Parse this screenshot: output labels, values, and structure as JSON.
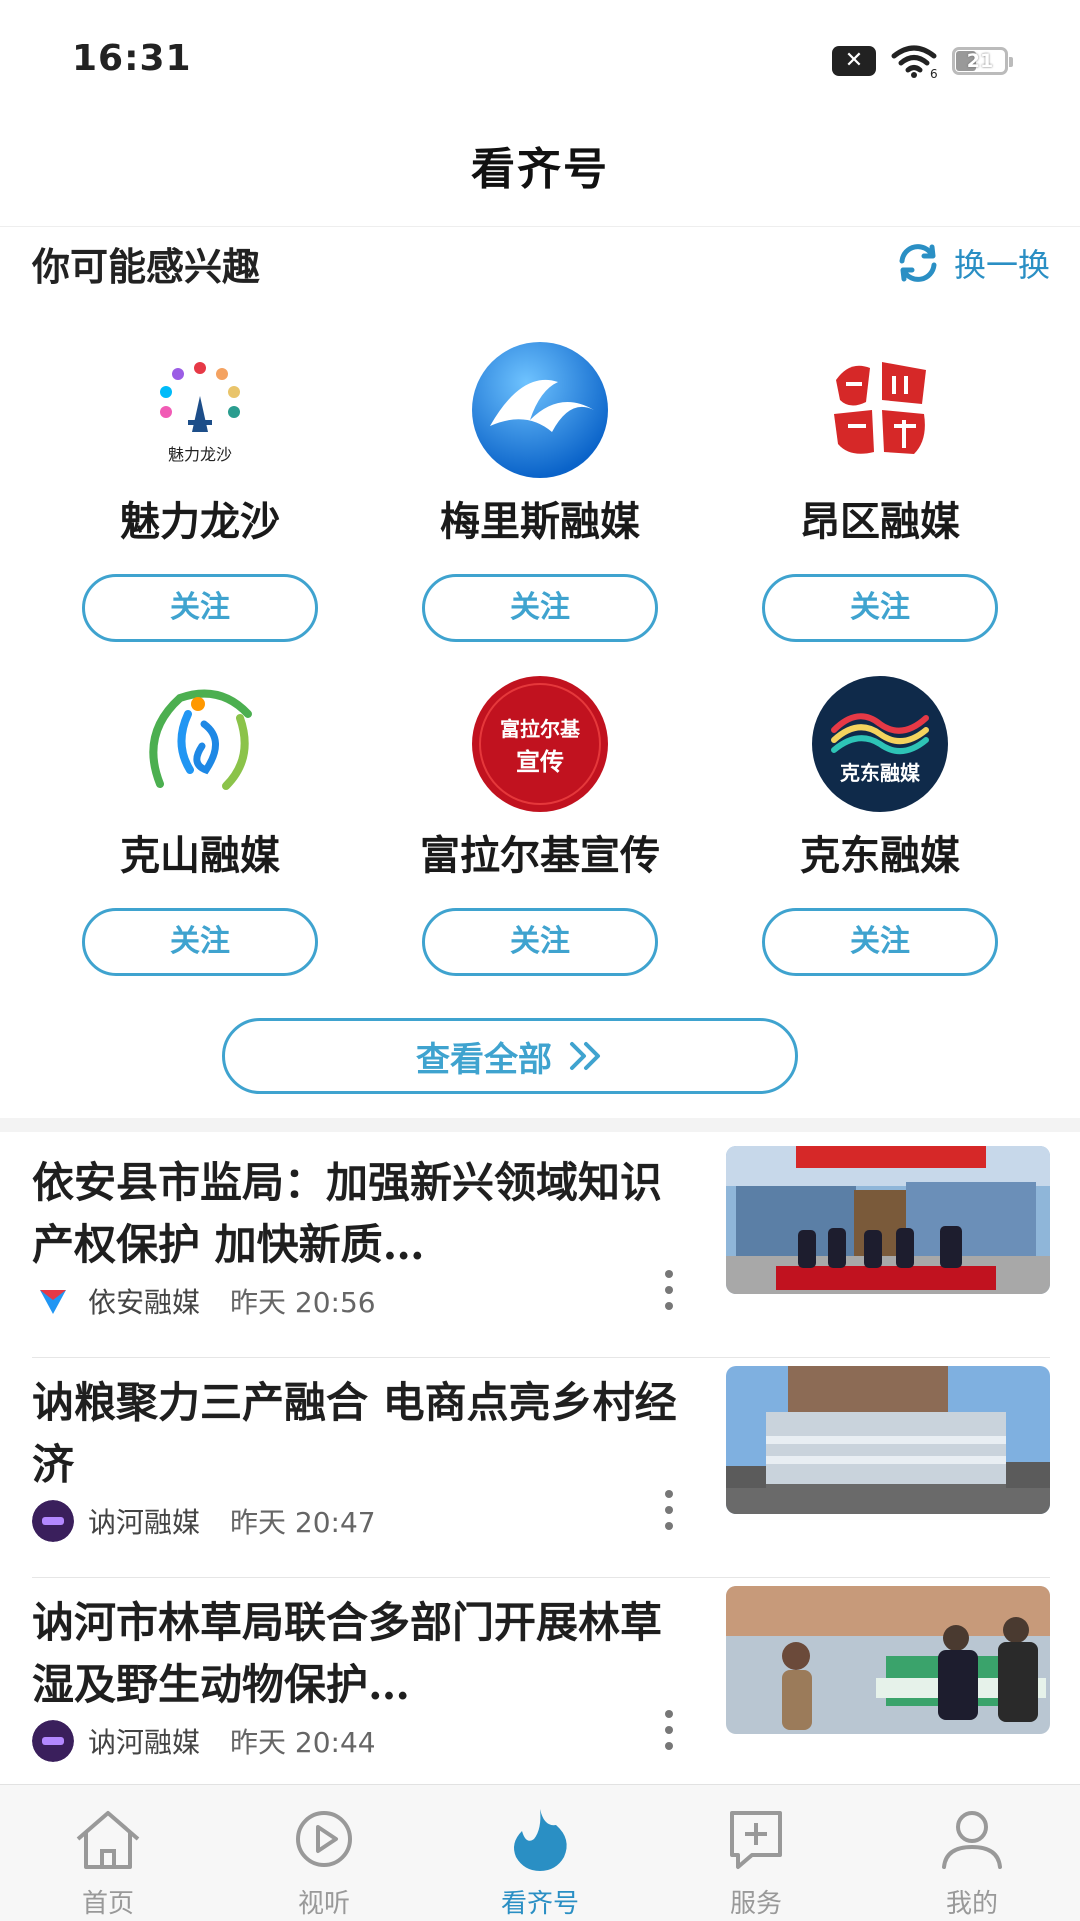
{
  "status_bar": {
    "time": "16:31",
    "battery": "21",
    "wifi_label": "6"
  },
  "header": {
    "title": "看齐号"
  },
  "interest": {
    "title": "你可能感兴趣",
    "refresh_label": "换一换",
    "follow_label": "关注",
    "accounts": [
      {
        "name": "魅力龙沙",
        "logo_text": "魅力龙沙"
      },
      {
        "name": "梅里斯融媒"
      },
      {
        "name": "昂区融媒"
      },
      {
        "name": "克山融媒"
      },
      {
        "name": "富拉尔基宣传",
        "logo_text": "富拉尔基宣传"
      },
      {
        "name": "克东融媒",
        "logo_text": "克东融媒"
      }
    ],
    "view_all_label": "查看全部"
  },
  "news": [
    {
      "title": "依安县市监局：加强新兴领域知识产权保护 加快新质…",
      "source": "依安融媒",
      "time": "昨天 20:56"
    },
    {
      "title": "讷粮聚力三产融合 电商点亮乡村经济",
      "source": "讷河融媒",
      "time": "昨天 20:47"
    },
    {
      "title": "讷河市林草局联合多部门开展林草湿及野生动物保护…",
      "source": "讷河融媒",
      "time": "昨天 20:44"
    }
  ],
  "tabs": [
    {
      "label": "首页",
      "icon": "home-icon"
    },
    {
      "label": "视听",
      "icon": "play-icon"
    },
    {
      "label": "看齐号",
      "icon": "flame-icon",
      "active": true
    },
    {
      "label": "服务",
      "icon": "service-icon"
    },
    {
      "label": "我的",
      "icon": "profile-icon"
    }
  ],
  "colors": {
    "accent": "#3fa3cf",
    "tab_active": "#2a8fc4",
    "tab_inactive": "#999999"
  }
}
